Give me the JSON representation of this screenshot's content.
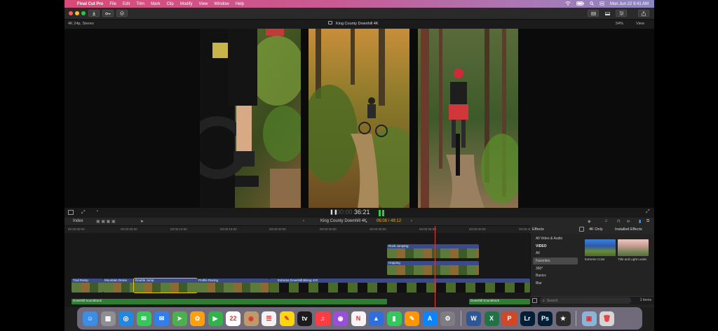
{
  "menubar": {
    "app_name": "Final Cut Pro",
    "items": [
      "File",
      "Edit",
      "Trim",
      "Mark",
      "Clip",
      "Modify",
      "View",
      "Window",
      "Help"
    ],
    "datetime": "Mon Jun 22  9:41 AM"
  },
  "viewer": {
    "format": "4K 24p, Stereo",
    "title": "King County Downhill 4K",
    "zoom": "54%",
    "view_label": "View",
    "timecode": "36:21"
  },
  "timeline": {
    "index_label": "Index",
    "project_name": "King County Downhill 4K",
    "duration": "06:08 / 49:12",
    "ruler_marks": [
      "00:00:00:00",
      "00:00:05:00",
      "00:00:10:00",
      "00:00:15:00",
      "00:00:20:00",
      "00:00:25:00",
      "00:00:30:00",
      "00:00:35:00",
      "00:00:40:00",
      "00:00:45:00"
    ],
    "clips": [
      {
        "label": "Rock Jumping"
      },
      {
        "label": "Hopping"
      },
      {
        "label": "Trail Ramp"
      },
      {
        "label": "Mountain Drone"
      },
      {
        "label": "Double Jump"
      },
      {
        "label": "Profile Racing"
      },
      {
        "label": "Extreme Downhill Biking 422"
      }
    ],
    "audio": [
      {
        "label": "Downhill Soundtrack"
      },
      {
        "label": "Downhill Soundtrack"
      }
    ]
  },
  "effects": {
    "title": "Effects",
    "filter": "4K Only",
    "installed": "Installed Effects",
    "categories": [
      "All Video & Audio",
      "VIDEO",
      "All",
      "Favorites",
      "360°",
      "Basics",
      "Blur"
    ],
    "selected_category": "Favorites",
    "items": [
      {
        "name": "Extreme Color"
      },
      {
        "name": "Title and Light Leaks"
      }
    ],
    "search_placeholder": "Search",
    "count": "2 items"
  },
  "dock": {
    "apps": [
      {
        "icon": "finder-icon",
        "color": "#3a8ee6",
        "glyph": "☺"
      },
      {
        "icon": "launchpad-icon",
        "color": "#8e8e93",
        "glyph": "▦"
      },
      {
        "icon": "safari-icon",
        "color": "#1e88e5",
        "glyph": "◎"
      },
      {
        "icon": "messages-icon",
        "color": "#34c759",
        "glyph": "✉"
      },
      {
        "icon": "mail-icon",
        "color": "#2f80ed",
        "glyph": "✉"
      },
      {
        "icon": "maps-icon",
        "color": "#4caf50",
        "glyph": "➤"
      },
      {
        "icon": "photos-icon",
        "color": "#ff9f0a",
        "glyph": "✿"
      },
      {
        "icon": "facetime-icon",
        "color": "#30b34a",
        "glyph": "▶"
      },
      {
        "icon": "calendar-icon",
        "color": "#ffffff",
        "glyph": "22"
      },
      {
        "icon": "contacts-icon",
        "color": "#c19a6b",
        "glyph": "◉"
      },
      {
        "icon": "reminders-icon",
        "color": "#f2f2f2",
        "glyph": "☰"
      },
      {
        "icon": "notes-icon",
        "color": "#ffd60a",
        "glyph": "✎"
      },
      {
        "icon": "apple-tv-icon",
        "color": "#1c1c1e",
        "glyph": "tv"
      },
      {
        "icon": "music-icon",
        "color": "#fc3c44",
        "glyph": "♫"
      },
      {
        "icon": "podcasts-icon",
        "color": "#9b4de0",
        "glyph": "◉"
      },
      {
        "icon": "news-icon",
        "color": "#f5f5f5",
        "glyph": "N"
      },
      {
        "icon": "keynote-icon",
        "color": "#2f6fdc",
        "glyph": "▲"
      },
      {
        "icon": "numbers-icon",
        "color": "#34c759",
        "glyph": "▮"
      },
      {
        "icon": "pages-icon",
        "color": "#ff9500",
        "glyph": "✎"
      },
      {
        "icon": "app-store-icon",
        "color": "#0a84ff",
        "glyph": "A"
      },
      {
        "icon": "system-preferences-icon",
        "color": "#7d7d82",
        "glyph": "⚙"
      },
      {
        "icon": "word-icon",
        "color": "#2b579a",
        "glyph": "W"
      },
      {
        "icon": "excel-icon",
        "color": "#217346",
        "glyph": "X"
      },
      {
        "icon": "powerpoint-icon",
        "color": "#d24726",
        "glyph": "P"
      },
      {
        "icon": "lightroom-icon",
        "color": "#001e36",
        "glyph": "Lr"
      },
      {
        "icon": "photoshop-icon",
        "color": "#001e36",
        "glyph": "Ps"
      },
      {
        "icon": "final-cut-pro-icon",
        "color": "#2b2b2b",
        "glyph": "★"
      },
      {
        "icon": "preview-icon",
        "color": "#8ab4d8",
        "glyph": "▣"
      },
      {
        "icon": "trash-icon",
        "color": "#d6d6d6",
        "glyph": "🗑"
      }
    ]
  }
}
